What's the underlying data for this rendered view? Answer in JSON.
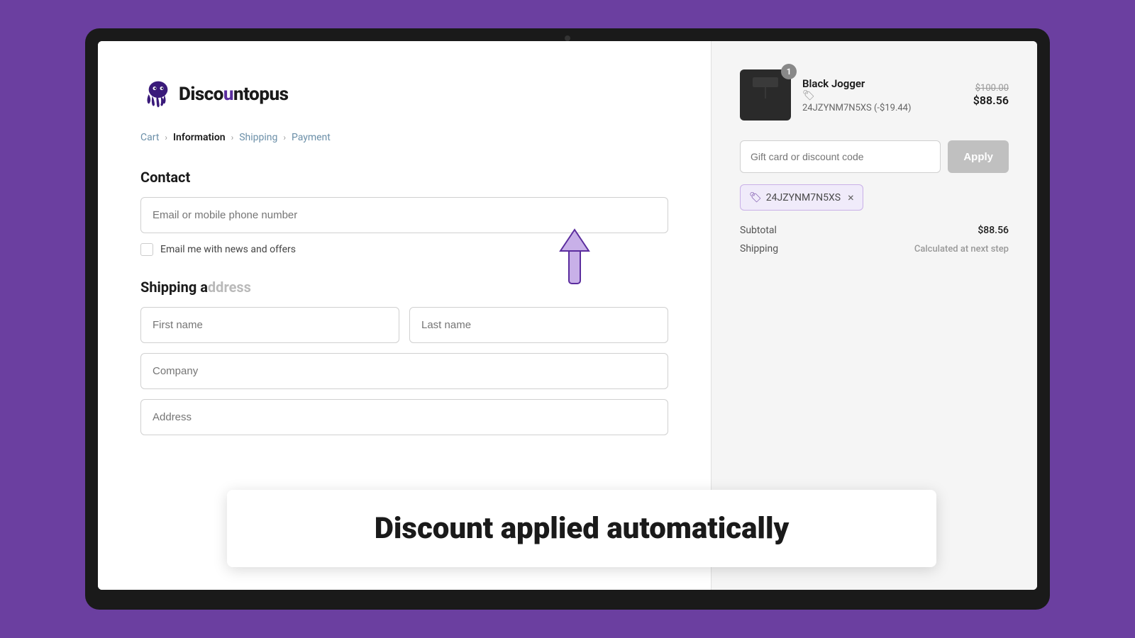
{
  "page": {
    "bg_color": "#6b3fa0",
    "camera_dot": true
  },
  "logo": {
    "text_before": "Disco",
    "text_highlight": "u",
    "text_after": "ntopus"
  },
  "breadcrumb": {
    "items": [
      {
        "label": "Cart",
        "active": false
      },
      {
        "label": "Information",
        "active": true
      },
      {
        "label": "Shipping",
        "active": false
      },
      {
        "label": "Payment",
        "active": false
      }
    ]
  },
  "contact_section": {
    "title": "Contact",
    "email_placeholder": "Email or mobile phone number",
    "checkbox_label": "Email me with news and offers"
  },
  "shipping_section": {
    "title": "Shipping address",
    "first_name_placeholder": "First name",
    "last_name_placeholder": "Last name",
    "company_placeholder": "Company",
    "address_placeholder": "Address"
  },
  "order_summary": {
    "product": {
      "name": "Black Jogger",
      "badge": "1",
      "code": "24JZYNM7N5XS (-$19.44)",
      "original_price": "$100.00",
      "discounted_price": "$88.56"
    },
    "discount_input_placeholder": "Gift card or discount code",
    "apply_button_label": "Apply",
    "applied_code": "24JZYNM7N5XS",
    "subtotal_label": "Subtotal",
    "subtotal_value": "$88.56",
    "shipping_label": "Shipping",
    "shipping_value": "Calculated at next step"
  },
  "annotation": {
    "text": "Discount applied automatically"
  }
}
